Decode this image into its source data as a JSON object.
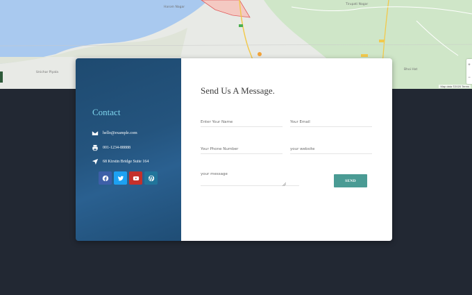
{
  "map": {
    "labels": [
      "Harom Nagar",
      "Tirupati Nagar",
      "Unichar Piyala",
      "Bhoi Hat"
    ],
    "footer": "Map data ©2020   Terms"
  },
  "contact": {
    "title": "Contact",
    "email": "hello@example.com",
    "phone": "001-1234-88888",
    "address": "68 Kirstin Bridge Suite 164",
    "socials": [
      {
        "name": "facebook",
        "color": "#3d5fa8"
      },
      {
        "name": "twitter",
        "color": "#1da1f2"
      },
      {
        "name": "youtube",
        "color": "#c4302b"
      },
      {
        "name": "wordpress",
        "color": "#21759b"
      }
    ]
  },
  "form": {
    "title": "Send Us A Message.",
    "name_placeholder": "Enter Your Name",
    "email_placeholder": "Your Email",
    "phone_placeholder": "Your Phone Number",
    "website_placeholder": "your website",
    "message_placeholder": "your message",
    "send_label": "SEND"
  }
}
